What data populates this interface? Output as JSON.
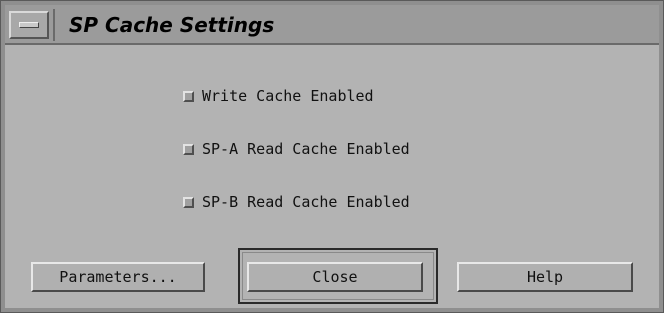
{
  "window": {
    "title": "SP Cache Settings"
  },
  "options": [
    {
      "label": "Write Cache Enabled",
      "checked": false
    },
    {
      "label": "SP-A Read Cache Enabled",
      "checked": false
    },
    {
      "label": "SP-B Read Cache Enabled",
      "checked": false
    }
  ],
  "buttons": {
    "parameters": "Parameters...",
    "close": "Close",
    "help": "Help"
  }
}
